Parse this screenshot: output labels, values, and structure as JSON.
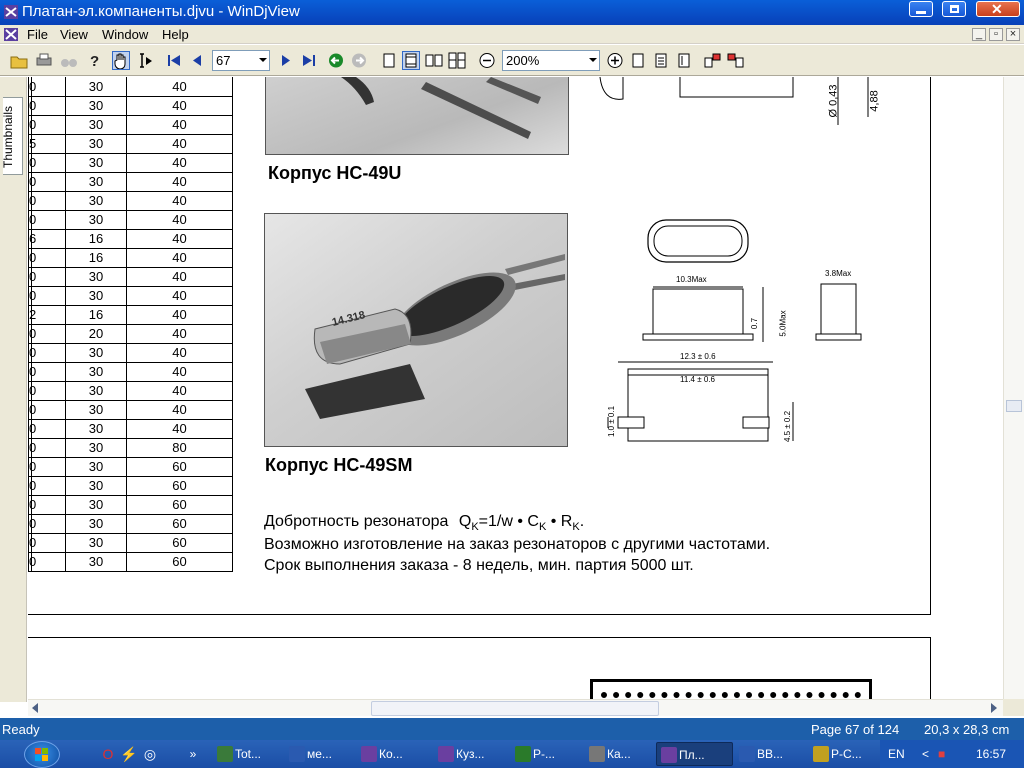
{
  "window": {
    "title": "Платан-эл.компаненты.djvu - WinDjView"
  },
  "menu": {
    "items": [
      "File",
      "View",
      "Window",
      "Help"
    ]
  },
  "toolbar": {
    "page_value": "67",
    "zoom_value": "200%"
  },
  "sidebar": {
    "tab_label": "Thumbnails"
  },
  "table": {
    "col_a": [
      "0",
      "0",
      "0",
      "5",
      "0",
      "0",
      "0",
      "0",
      "6",
      "0",
      "0",
      "0",
      "2",
      "0",
      "0",
      "0",
      "0",
      "0",
      "0",
      "0",
      "0",
      "0",
      "0",
      "0",
      "0",
      "0"
    ],
    "col_b": [
      "30",
      "30",
      "30",
      "30",
      "30",
      "30",
      "30",
      "30",
      "16",
      "16",
      "30",
      "30",
      "16",
      "20",
      "30",
      "30",
      "30",
      "30",
      "30",
      "30",
      "30",
      "30",
      "30",
      "30",
      "30",
      "30"
    ],
    "col_c": [
      "40",
      "40",
      "40",
      "40",
      "40",
      "40",
      "40",
      "40",
      "40",
      "40",
      "40",
      "40",
      "40",
      "40",
      "40",
      "40",
      "40",
      "40",
      "40",
      "80",
      "60",
      "60",
      "60",
      "60",
      "60",
      "60"
    ]
  },
  "document": {
    "caption_hc49u": "Корпус HC-49U",
    "caption_hc49sm": "Корпус HC-49SM",
    "q_text": "Добротность резонатора",
    "q_formula_prefix": "Q",
    "q_formula_sub1": "K",
    "q_formula_mid": "=1/w • C",
    "q_formula_sub2": "K",
    "q_formula_mid2": " • R",
    "q_formula_sub3": "K",
    "q_formula_end": ".",
    "line2": "Возможно изготовление на заказ резонаторов с другими частотами.",
    "line3": "Срок выполнения заказа - 8 недель, мин. партия  5000 шт.",
    "photo_label": "14.318",
    "dims": {
      "d1": "10.3Max",
      "d2": "3.8Max",
      "d3": "0.7",
      "d4": "5.0Max",
      "d5": "12.3 ± 0.6",
      "d6": "11.4 ± 0.6",
      "d7": "1.0 ± 0.1",
      "d8": "4.5 ± 0.2",
      "d9": "Ø 0,43",
      "d10": "4,88"
    }
  },
  "status": {
    "left": "Ready",
    "page": "Page 67 of 124",
    "size": "20,3 x 28,3 cm"
  },
  "taskbar": {
    "tasks": [
      "Tot...",
      "ме...",
      "Ко...",
      "Куз...",
      "Р-...",
      "Ка...",
      "Пл...",
      "ВВ...",
      "P-C..."
    ],
    "lang": "EN",
    "clock": "16:57"
  },
  "colors": {
    "titlebar": "#0a5fd8",
    "statusbar": "#1d5faa",
    "taskbar": "#1b4ea6",
    "menubar": "#ece9d8"
  }
}
